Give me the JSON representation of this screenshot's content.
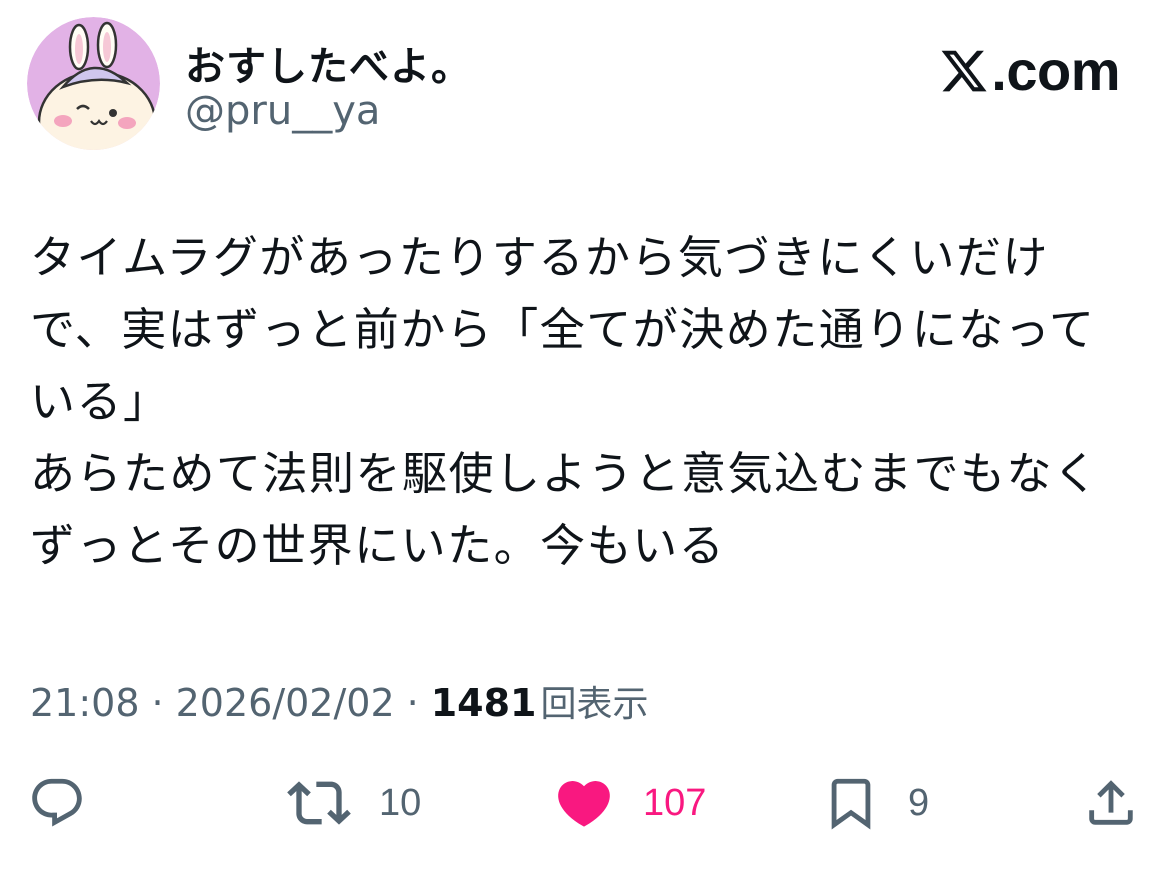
{
  "author": {
    "display_name": "おすしたべよ。",
    "handle": "@pru__ya",
    "avatar_icon": "bunny-character-avatar"
  },
  "site": {
    "logo_text": ".com",
    "logo_icon": "x-logo-icon"
  },
  "tweet": {
    "lines": [
      "タイムラグがあったりするから気づきにくいだけ",
      "で、実はずっと前から「全てが決めた通りになって",
      "いる」",
      "あらためて法則を駆使しようと意気込むまでもなく",
      "ずっとその世界にいた。今もいる"
    ]
  },
  "meta": {
    "time": "21:08",
    "separator": "·",
    "date": "2026/02/02",
    "views_count": "1481",
    "views_label": "回表示"
  },
  "actions": {
    "reply": {
      "icon": "reply-icon"
    },
    "retweet": {
      "icon": "retweet-icon",
      "count": "10"
    },
    "like": {
      "icon": "heart-icon",
      "count": "107",
      "liked": true
    },
    "bookmark": {
      "icon": "bookmark-icon",
      "count": "9"
    },
    "share": {
      "icon": "share-icon"
    }
  },
  "colors": {
    "text": "#0f1419",
    "secondary": "#536471",
    "like": "#f91880",
    "avatar_bg": "#e6b3e6"
  }
}
